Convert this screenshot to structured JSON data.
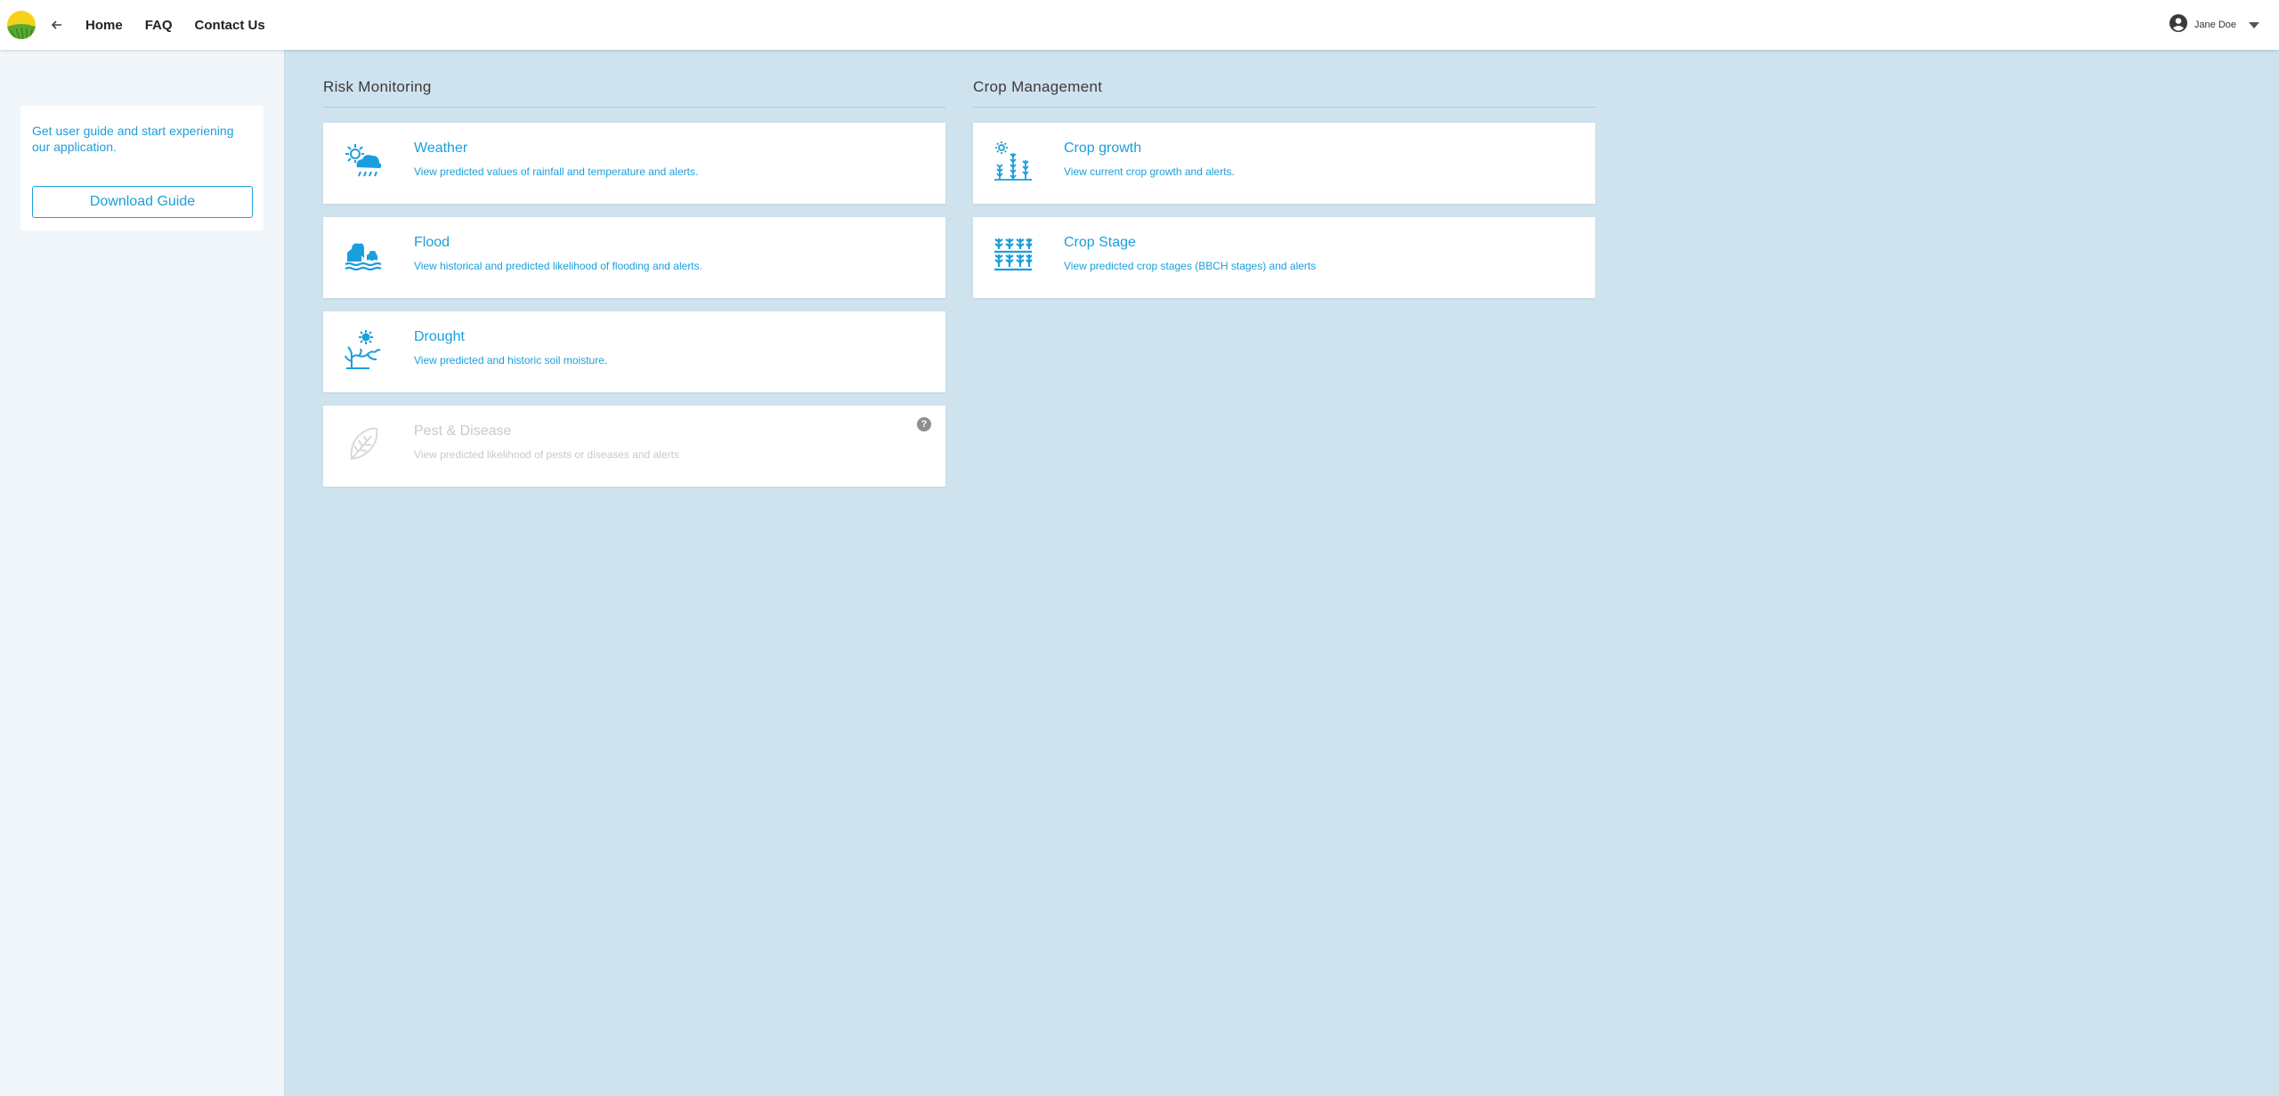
{
  "header": {
    "nav": [
      {
        "label": "Home"
      },
      {
        "label": "FAQ"
      },
      {
        "label": "Contact Us"
      }
    ],
    "user": {
      "name": "Jane Doe",
      "icon": "account-circle-icon"
    }
  },
  "sidebar": {
    "guide_text": "Get user guide and start experiening our application.",
    "download_label": "Download Guide"
  },
  "sections": {
    "risk": {
      "title": "Risk Monitoring",
      "cards": [
        {
          "title": "Weather",
          "desc": "View predicted values of rainfall and temperature and alerts.",
          "icon": "weather-icon"
        },
        {
          "title": "Flood",
          "desc": "View historical and predicted likelihood of flooding and alerts.",
          "icon": "flood-icon"
        },
        {
          "title": "Drought",
          "desc": "View predicted and historic soil moisture.",
          "icon": "drought-icon"
        },
        {
          "title": "Pest & Disease",
          "desc": "View predicted likelihood of pests or diseases and alerts",
          "icon": "leaf-icon",
          "disabled": true,
          "badge": "?"
        }
      ]
    },
    "crop": {
      "title": "Crop Management",
      "cards": [
        {
          "title": "Crop growth",
          "desc": "View current crop growth and alerts.",
          "icon": "crop-growth-icon"
        },
        {
          "title": "Crop Stage",
          "desc": "View predicted crop stages (BBCH stages) and alerts",
          "icon": "crop-stage-icon"
        }
      ]
    }
  },
  "colors": {
    "accent": "#1a9fdc",
    "background": "#cfe3ee",
    "disabled": "#c9c9c9"
  }
}
